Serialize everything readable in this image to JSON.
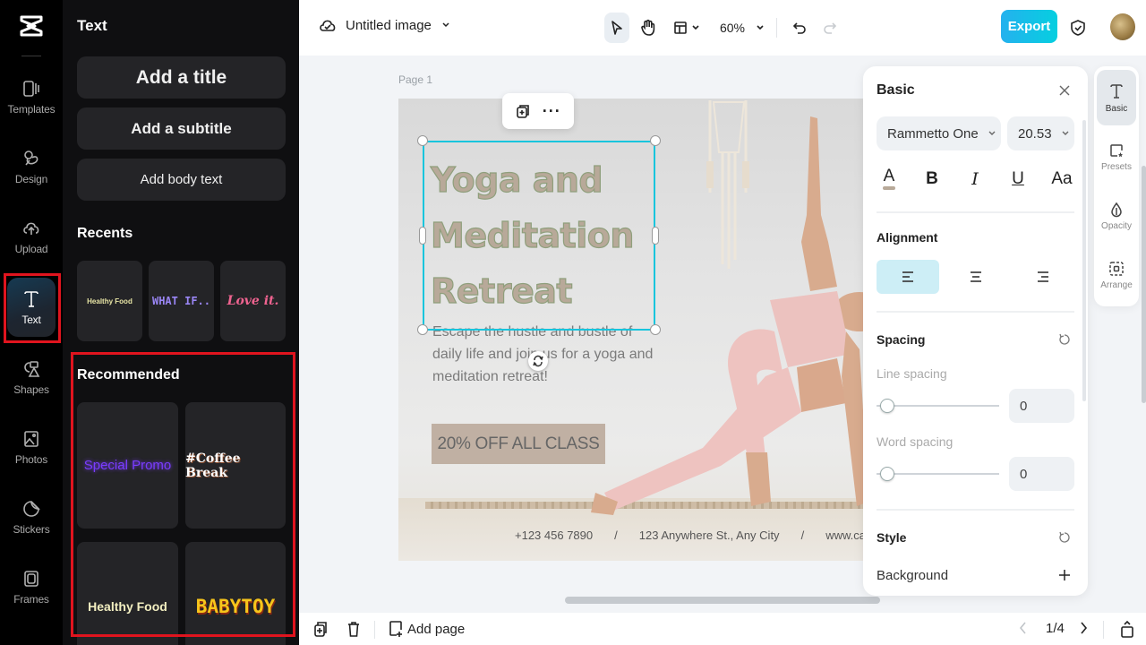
{
  "rail": {
    "items": [
      {
        "label": "Templates",
        "icon": "templates-icon"
      },
      {
        "label": "Design",
        "icon": "design-icon"
      },
      {
        "label": "Upload",
        "icon": "upload-cloud-icon"
      },
      {
        "label": "Text",
        "icon": "text-t-icon",
        "active": true
      },
      {
        "label": "Shapes",
        "icon": "shapes-icon"
      },
      {
        "label": "Photos",
        "icon": "photo-icon"
      },
      {
        "label": "Stickers",
        "icon": "sticker-icon"
      },
      {
        "label": "Frames",
        "icon": "frame-icon"
      }
    ]
  },
  "panel": {
    "title": "Text",
    "add_title": "Add a title",
    "add_subtitle": "Add a subtitle",
    "add_body": "Add body text",
    "recents_heading": "Recents",
    "recents": [
      "Healthy Food",
      "WHAT IF..",
      "Love it."
    ],
    "recommended_heading": "Recommended",
    "recommended": [
      "Special Promo",
      "#Coffee Break",
      "Healthy Food",
      "BABYTOY"
    ]
  },
  "topbar": {
    "doc_title": "Untitled image",
    "zoom": "60%",
    "export_label": "Export"
  },
  "canvas": {
    "page_label": "Page 1",
    "headline_lines": [
      "Yoga and",
      "Meditation",
      "Retreat"
    ],
    "body_lines": [
      "Escape the hustle and bustle of",
      "daily life and join us for a yoga and",
      "meditation retreat!"
    ],
    "promo": "20% OFF ALL CLASS",
    "footer": [
      "+123 456 7890",
      "/",
      "123 Anywhere St., Any City",
      "/",
      "www.ca"
    ]
  },
  "props": {
    "title": "Basic",
    "font": "Rammetto One",
    "font_size": "20.53",
    "format_buttons": [
      "A",
      "B",
      "I",
      "U",
      "Aa"
    ],
    "text_color": "#b8a999",
    "alignment_heading": "Alignment",
    "alignment_selected": "left",
    "spacing_heading": "Spacing",
    "line_spacing_label": "Line spacing",
    "line_spacing_value": "0",
    "word_spacing_label": "Word spacing",
    "word_spacing_value": "0",
    "style_heading": "Style",
    "background_label": "Background"
  },
  "side_tabs": [
    {
      "label": "Basic",
      "active": true
    },
    {
      "label": "Presets"
    },
    {
      "label": "Opacity"
    },
    {
      "label": "Arrange"
    }
  ],
  "bottombar": {
    "add_page": "Add page",
    "page_indicator": "1/4"
  },
  "colors": {
    "accent": "#17c5dd",
    "export_gradient_start": "#25b1ee",
    "export_gradient_end": "#05cfe0",
    "highlight_box": "#e0141e"
  }
}
